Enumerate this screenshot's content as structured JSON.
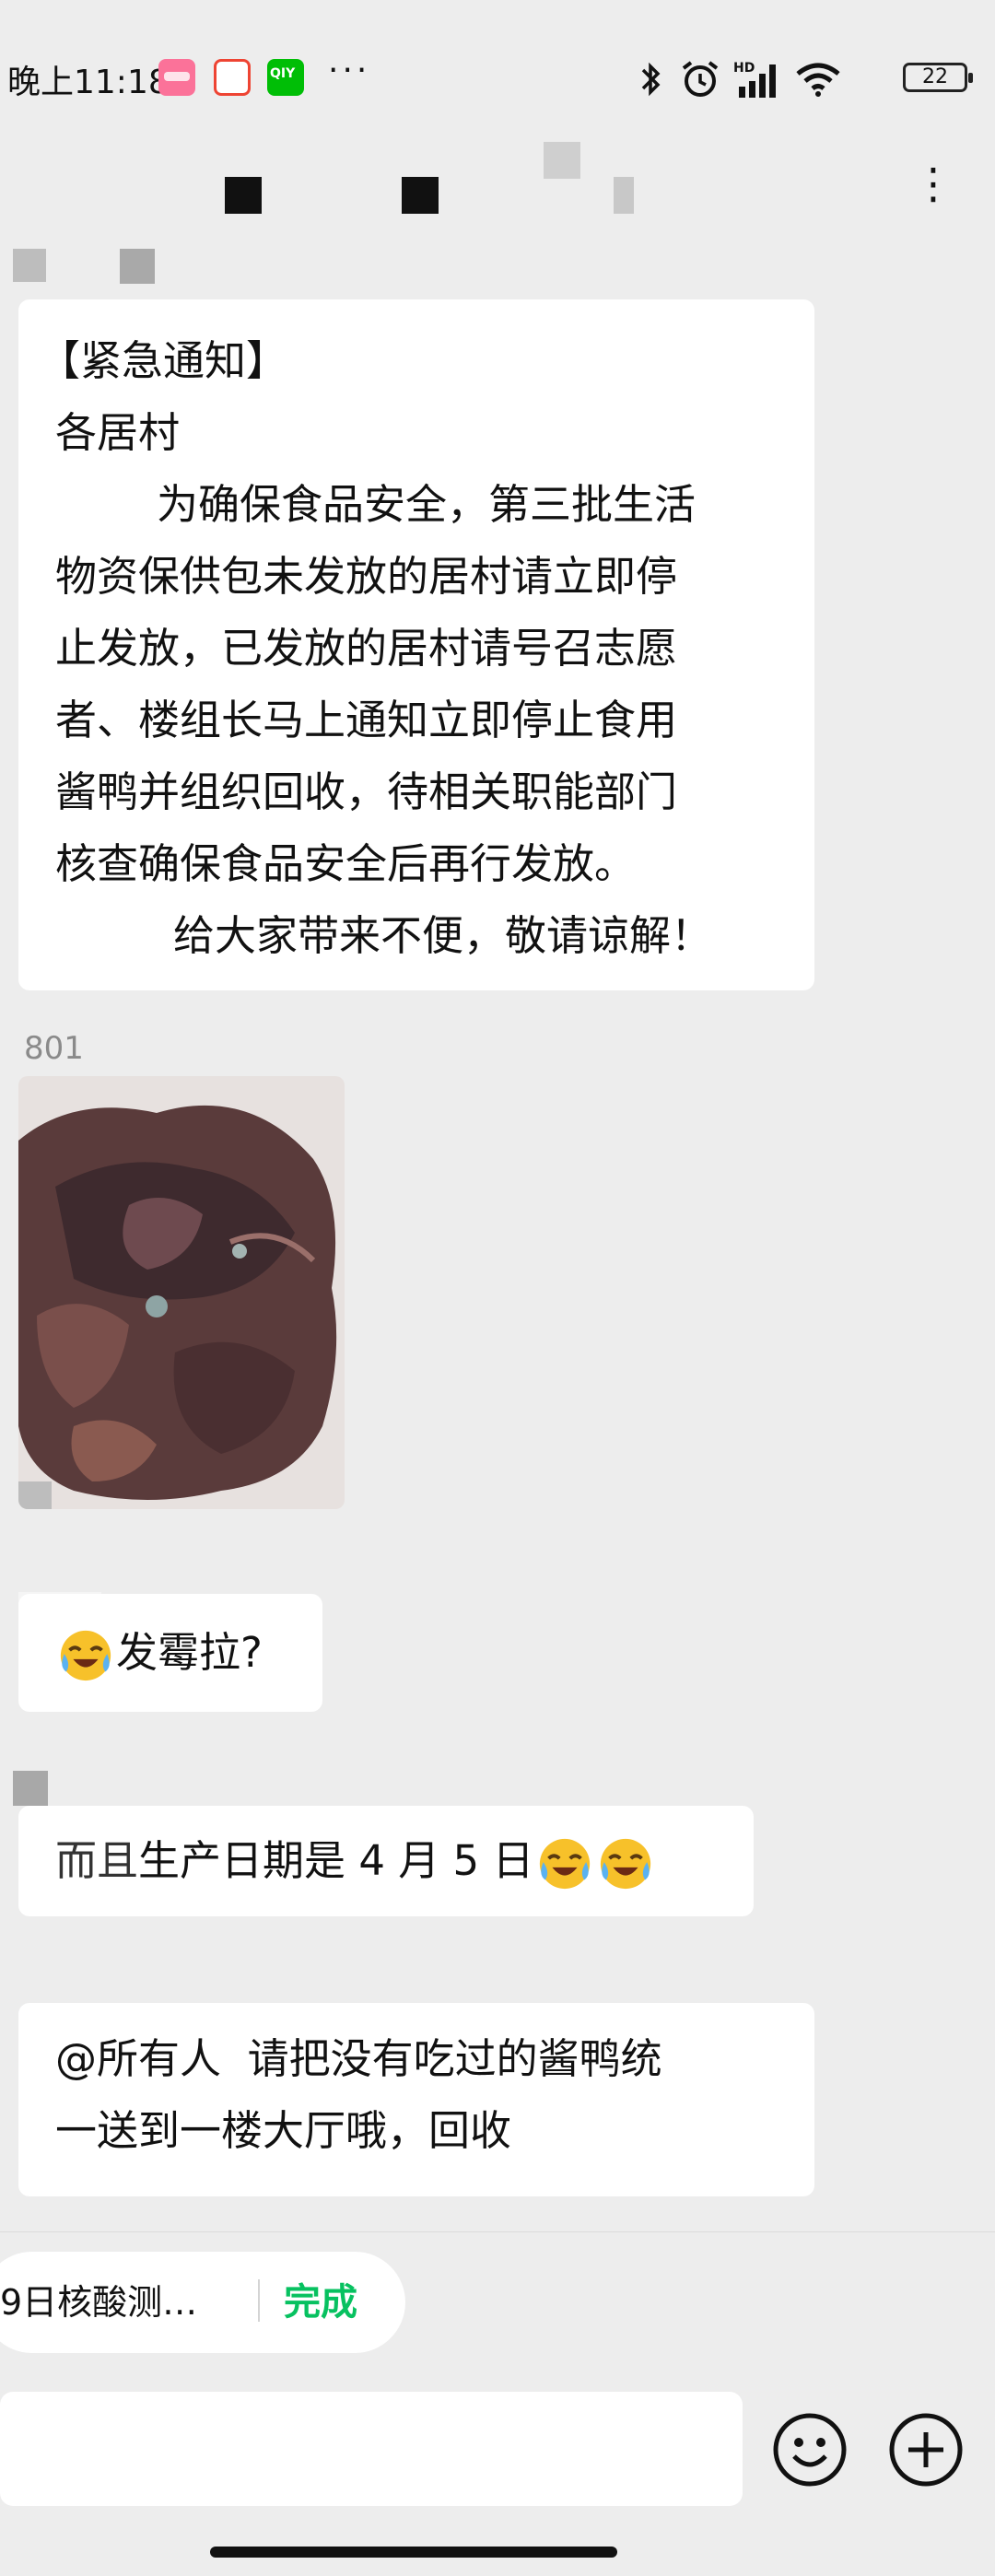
{
  "status_bar": {
    "time": "晚上11:18",
    "more_dots": "···",
    "battery": "22"
  },
  "chat_header": {
    "more_label": "⋮"
  },
  "messages": [
    {
      "type": "text",
      "lines": [
        "【紧急通知】",
        "各居村",
        "为确保食品安全，第三批生活",
        "物资保供包未发放的居村请立即停",
        "止发放，已发放的居村请号召志愿",
        "者、楼组长马上通知立即停止食用",
        "酱鸭并组织回收，待相关职能部门",
        "核查确保食品安全后再行发放。",
        "给大家带来不便，敬请谅解！"
      ]
    },
    {
      "type": "image",
      "sender": "801"
    },
    {
      "type": "text",
      "text": "发霉拉?"
    },
    {
      "type": "text",
      "prefix": "而且",
      "text": "生产日期是 4 月 5 日"
    },
    {
      "type": "text",
      "lines": [
        "@所有人  请把没有吃过的酱鸭统",
        "一送到一楼大厅哦，回收"
      ]
    }
  ],
  "quick_bar": {
    "chip_text": "9日核酸测…",
    "done_label": "完成"
  },
  "colors": {
    "background": "#ededed",
    "bubble": "#ffffff",
    "accent_green": "#07c160"
  },
  "icons": [
    "bluetooth-icon",
    "alarm-icon",
    "signal-icon",
    "wifi-icon",
    "battery-icon",
    "more-icon",
    "emoji-icon",
    "plus-icon"
  ]
}
